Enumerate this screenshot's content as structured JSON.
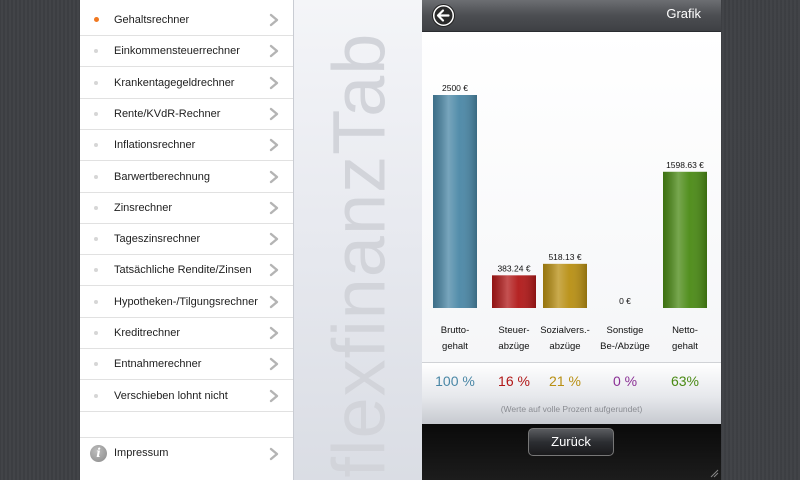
{
  "sidebar": {
    "items": [
      {
        "label": "Gehaltsrechner",
        "active": true
      },
      {
        "label": "Einkommensteuerrechner",
        "active": false
      },
      {
        "label": "Krankentagegeldrechner",
        "active": false
      },
      {
        "label": "Rente/KVdR-Rechner",
        "active": false
      },
      {
        "label": "Inflationsrechner",
        "active": false
      },
      {
        "label": "Barwertberechnung",
        "active": false
      },
      {
        "label": "Zinsrechner",
        "active": false
      },
      {
        "label": "Tageszinsrechner",
        "active": false
      },
      {
        "label": "Tatsächliche Rendite/Zinsen",
        "active": false
      },
      {
        "label": "Hypotheken-/Tilgungsrechner",
        "active": false
      },
      {
        "label": "Kreditrechner",
        "active": false
      },
      {
        "label": "Entnahmerechner",
        "active": false
      },
      {
        "label": "Verschieben lohnt nicht",
        "active": false
      }
    ],
    "impressum": {
      "icon_letter": "i",
      "label": "Impressum"
    }
  },
  "watermark": "flexfinanzTab",
  "panel": {
    "title": "Grafik",
    "back_icon": "back-arrow-icon",
    "note": "(Werte auf volle Prozent aufgerundet)",
    "zurueck_label": "Zurück",
    "accent_active": "#f07820"
  },
  "chart_data": {
    "type": "bar",
    "categories": [
      [
        "Brutto-",
        "gehalt"
      ],
      [
        "Steuer-",
        "abzüge"
      ],
      [
        "Sozialvers.-",
        "abzüge"
      ],
      [
        "Sonstige",
        "Be-/Abzüge"
      ],
      [
        "Netto-",
        "gehalt"
      ]
    ],
    "values": [
      2500,
      383.24,
      518.13,
      0,
      1598.63
    ],
    "value_labels": [
      "2500 €",
      "383.24 €",
      "518.13 €",
      "0 €",
      "1598.63 €"
    ],
    "percent_labels": [
      "100 %",
      "16 %",
      "21 %",
      "0 %",
      "63%"
    ],
    "colors": [
      "#4a87a6",
      "#b11818",
      "#b88f12",
      "#8a2f95",
      "#4a8a14"
    ],
    "ylim": [
      0,
      2500
    ]
  }
}
